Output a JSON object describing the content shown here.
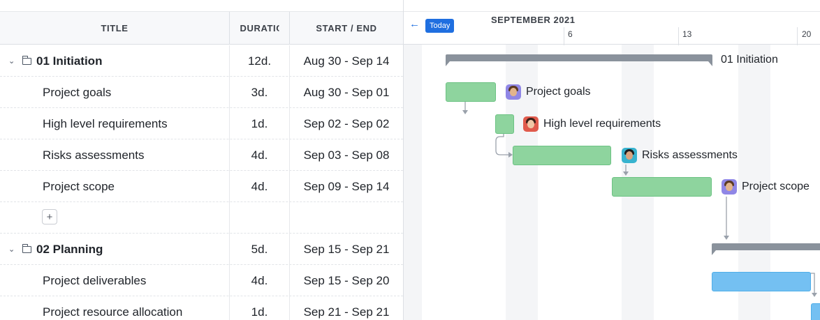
{
  "columns": {
    "title": "TITLE",
    "duration": "DURATION",
    "start_end": "START / END"
  },
  "rows": [
    {
      "kind": "group",
      "title": "01 Initiation",
      "duration": "12d.",
      "dates": "Aug 30 - Sep 14"
    },
    {
      "kind": "task",
      "title": "Project goals",
      "duration": "3d.",
      "dates": "Aug 30 - Sep 01"
    },
    {
      "kind": "task",
      "title": "High level requirements",
      "duration": "1d.",
      "dates": "Sep 02 - Sep 02"
    },
    {
      "kind": "task",
      "title": "Risks assessments",
      "duration": "4d.",
      "dates": "Sep 03 - Sep 08"
    },
    {
      "kind": "task",
      "title": "Project scope",
      "duration": "4d.",
      "dates": "Sep 09 - Sep 14"
    },
    {
      "kind": "add",
      "label": "+"
    },
    {
      "kind": "group",
      "title": "02 Planning",
      "duration": "5d.",
      "dates": "Sep 15 - Sep 21"
    },
    {
      "kind": "task",
      "title": "Project deliverables",
      "duration": "4d.",
      "dates": "Sep 15 - Sep 20"
    },
    {
      "kind": "task",
      "title": "Project resource allocation",
      "duration": "1d.",
      "dates": "Sep 21 - Sep 21"
    }
  ],
  "timeline": {
    "today_label": "Today",
    "back_arrow": "←",
    "month": "SEPTEMBER 2021",
    "day_ticks": [
      "6",
      "13",
      "20"
    ]
  },
  "bar_labels": {
    "initiation": "01 Initiation",
    "goals": "Project goals",
    "requirements": "High level requirements",
    "risks": "Risks assessments",
    "scope": "Project scope"
  },
  "colors": {
    "accent": "#1f6fe0",
    "task_green": "#8ed49e",
    "task_blue": "#74c0f2",
    "summary_gray": "#8a929c"
  },
  "icons": {
    "expand": "chevron-down-icon",
    "folder": "folder-icon",
    "back": "arrow-left-icon"
  }
}
